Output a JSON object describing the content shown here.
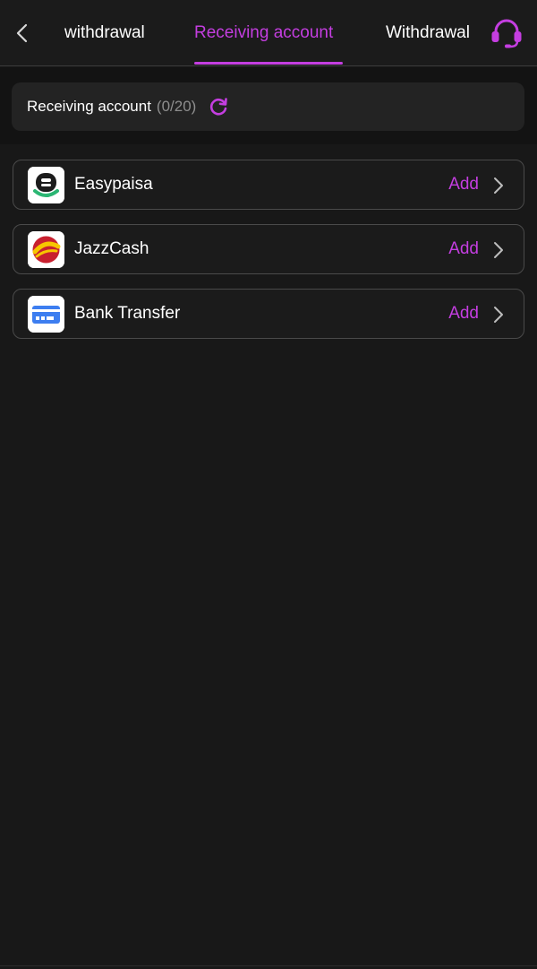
{
  "nav": {
    "tabs": [
      {
        "label": "withdrawal"
      },
      {
        "label": "Receiving account"
      },
      {
        "label": "Withdrawal"
      }
    ],
    "active_tab": 1,
    "accent_color": "#c43ee0"
  },
  "summary": {
    "title": "Receiving account",
    "count": "(0/20)"
  },
  "accounts": [
    {
      "name": "Easypaisa",
      "action": "Add",
      "icon": "easypaisa-logo"
    },
    {
      "name": "JazzCash",
      "action": "Add",
      "icon": "jazzcash-logo"
    },
    {
      "name": "Bank Transfer",
      "action": "Add",
      "icon": "bank-card-icon"
    }
  ],
  "icons": {
    "back": "chevron-left-icon",
    "support": "headset-icon",
    "refresh": "refresh-icon",
    "row_arrow": "chevron-right-icon"
  }
}
